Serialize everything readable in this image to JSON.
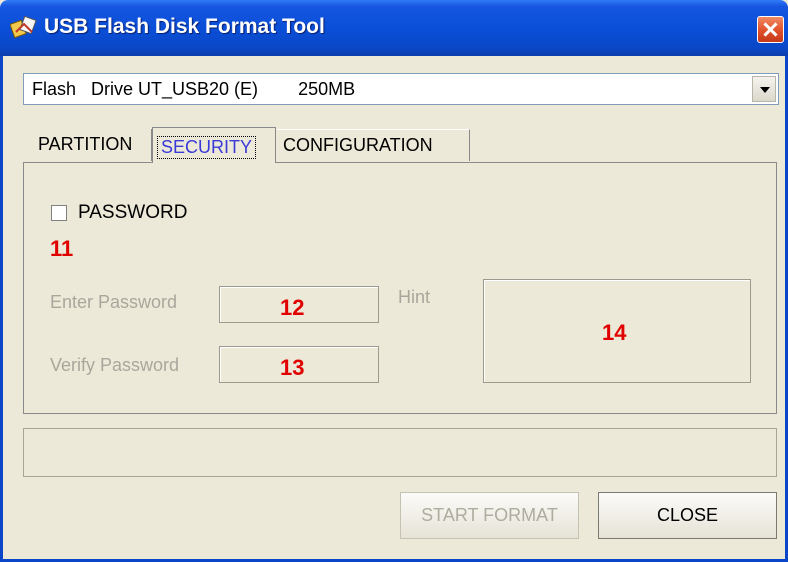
{
  "window": {
    "title": "USB Flash Disk Format Tool"
  },
  "drive": {
    "selected": "Flash   Drive UT_USB20 (E)        250MB"
  },
  "tabs": [
    {
      "label": "PARTITION"
    },
    {
      "label": "SECURITY"
    },
    {
      "label": "CONFIGURATION"
    }
  ],
  "security": {
    "password_label": "PASSWORD",
    "password_checked": false,
    "enter_password_label": "Enter Password",
    "verify_password_label": "Verify Password",
    "hint_label": "Hint",
    "enter_password_value": "",
    "verify_password_value": "",
    "hint_value": ""
  },
  "callouts": {
    "c11": "11",
    "c12": "12",
    "c13": "13",
    "c14": "14"
  },
  "buttons": {
    "start_format": "START FORMAT",
    "close": "CLOSE"
  },
  "icons": {
    "app": "usb-drive-icon",
    "close": "close-icon",
    "dropdown": "chevron-down-icon"
  },
  "colors": {
    "titlebar": "#0a4fd8",
    "callout": "#e00000",
    "disabled_text": "#a9a79c"
  }
}
